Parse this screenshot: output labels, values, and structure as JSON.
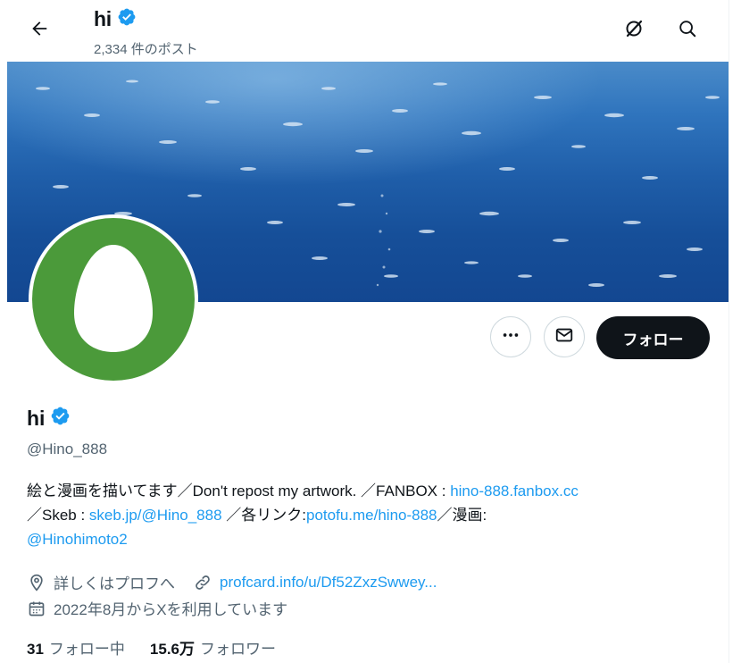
{
  "header": {
    "name": "hi",
    "post_count": "2,334 件のポスト"
  },
  "profile": {
    "name": "hi",
    "handle": "@Hino_888",
    "follow_label": "フォロー",
    "bio": {
      "line1_text": "絵と漫画を描いてます／Don't repost my artwork. ／FANBOX : ",
      "line1_link": "hino-888.fanbox.cc",
      "line2_prefix": "／Skeb : ",
      "line2_link1": "skeb.jp/@Hino_888",
      "line2_mid": " ／各リンク:",
      "line2_link2": "potofu.me/hino-888",
      "line2_suffix": "／漫画:",
      "line3_link": "@Hinohimoto2"
    },
    "location": "詳しくはプロフへ",
    "website": "profcard.info/u/Df52ZxzSwwey...",
    "joined": "2022年8月からXを利用しています",
    "following_count": "31",
    "following_label": "フォロー中",
    "followers_count": "15.6万",
    "followers_label": "フォロワー"
  },
  "colors": {
    "accent": "#1d9bf0",
    "text": "#0f1419",
    "secondary": "#536471",
    "avatar_green": "#4b9a3a",
    "verified_badge": "#1d9bf0"
  },
  "icons": [
    "back-arrow-icon",
    "verified-badge-icon",
    "grok-icon",
    "search-icon",
    "more-icon",
    "message-icon",
    "location-icon",
    "link-icon",
    "calendar-icon"
  ]
}
